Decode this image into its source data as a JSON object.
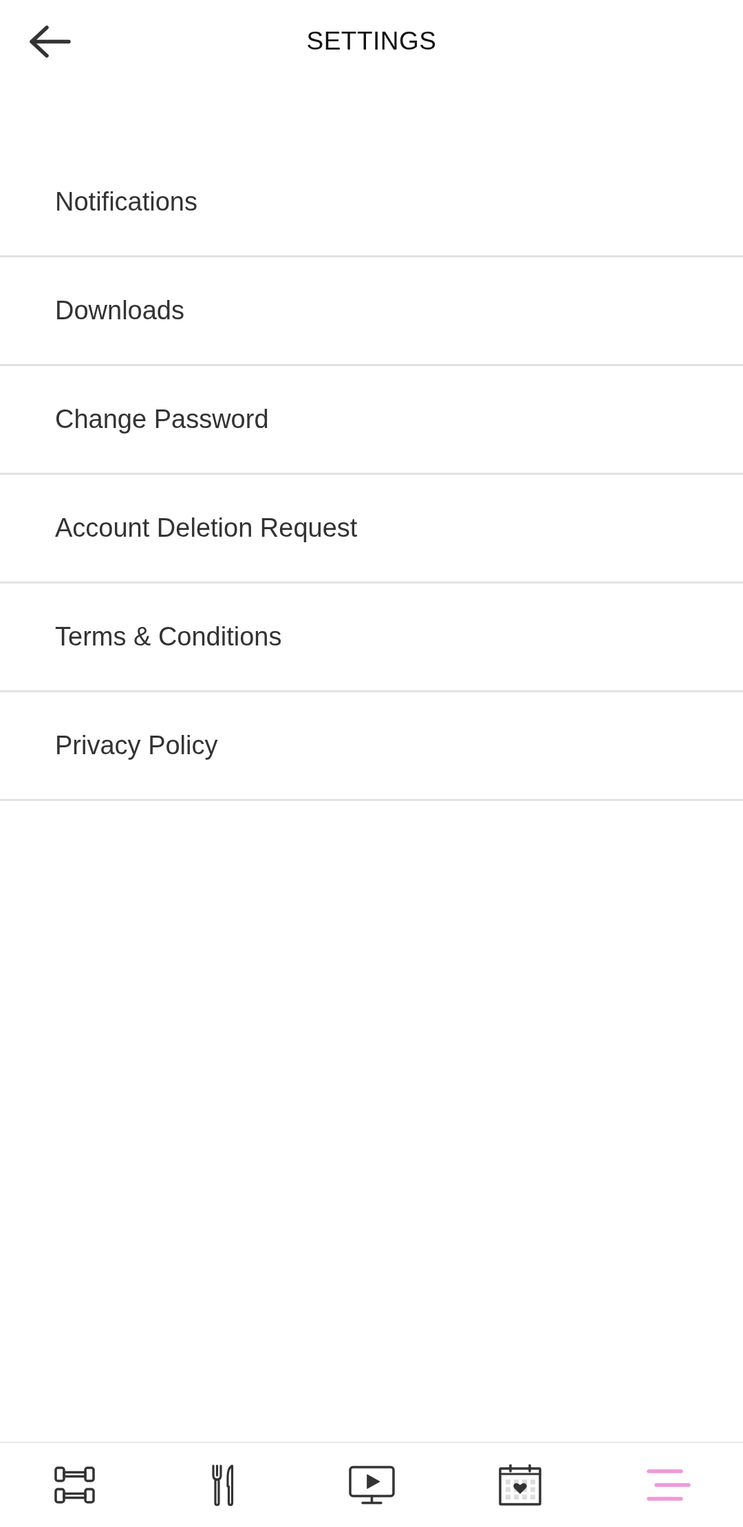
{
  "header": {
    "title": "SETTINGS"
  },
  "settings_items": [
    "Notifications",
    "Downloads",
    "Change Password",
    "Account Deletion Request",
    "Terms & Conditions",
    "Privacy Policy"
  ],
  "nav": [
    {
      "kind": "dumbbells",
      "selected": false
    },
    {
      "kind": "cutlery",
      "selected": false
    },
    {
      "kind": "monitor",
      "selected": false
    },
    {
      "kind": "calendar",
      "selected": false
    },
    {
      "kind": "menu",
      "selected": true
    }
  ]
}
